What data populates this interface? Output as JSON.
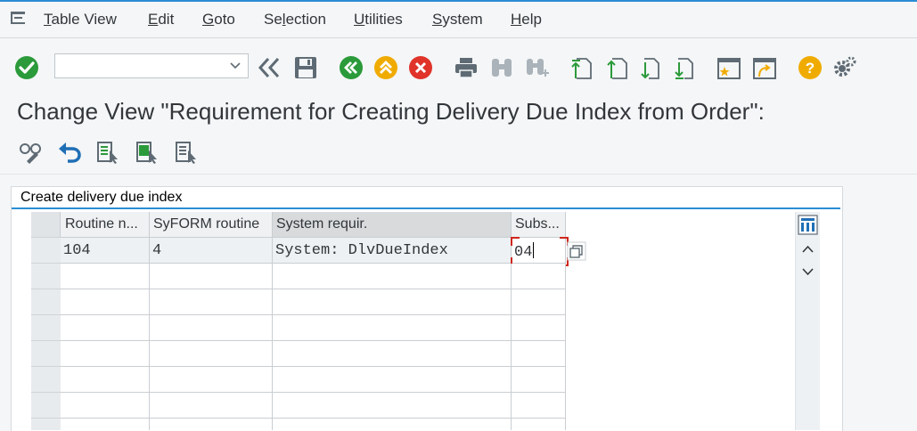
{
  "menubar": {
    "items": [
      {
        "label": "Table View",
        "mnemonic": "T"
      },
      {
        "label": "Edit",
        "mnemonic": "E"
      },
      {
        "label": "Goto",
        "mnemonic": "G"
      },
      {
        "label": "Selection",
        "mnemonic": "l"
      },
      {
        "label": "Utilities",
        "mnemonic": "U"
      },
      {
        "label": "System",
        "mnemonic": "S"
      },
      {
        "label": "Help",
        "mnemonic": "H"
      }
    ]
  },
  "toolbar": {
    "command_field": {
      "value": "",
      "placeholder": ""
    },
    "icons": [
      "enter-icon",
      "back-history-icon",
      "save-icon",
      "back-icon",
      "exit-icon",
      "cancel-icon",
      "print-icon",
      "find-icon",
      "find-next-icon",
      "first-page-icon",
      "previous-page-icon",
      "next-page-icon",
      "last-page-icon",
      "create-session-icon",
      "shortcut-icon",
      "help-icon",
      "settings-icon"
    ]
  },
  "page": {
    "title": "Change View \"Requirement for Creating Delivery Due Index from Order\":"
  },
  "app_toolbar": {
    "icons": [
      "display-change-icon",
      "undo-icon",
      "select-all-icon",
      "select-block-icon",
      "deselect-all-icon"
    ]
  },
  "panel": {
    "title": "Create delivery due index"
  },
  "table": {
    "columns": [
      "Routine n...",
      "SyFORM routine",
      "System requir.",
      "Subs..."
    ],
    "rows": [
      {
        "routine": "104",
        "syform": "4",
        "system_requirement": "System: DlvDueIndex",
        "subsequent": "04"
      }
    ]
  },
  "colors": {
    "accent": "#2a8dd4",
    "enter_green": "#2b9a3a",
    "cancel_red": "#e0332a",
    "help_orange": "#f0ab00",
    "edit_red": "#d0271d"
  }
}
